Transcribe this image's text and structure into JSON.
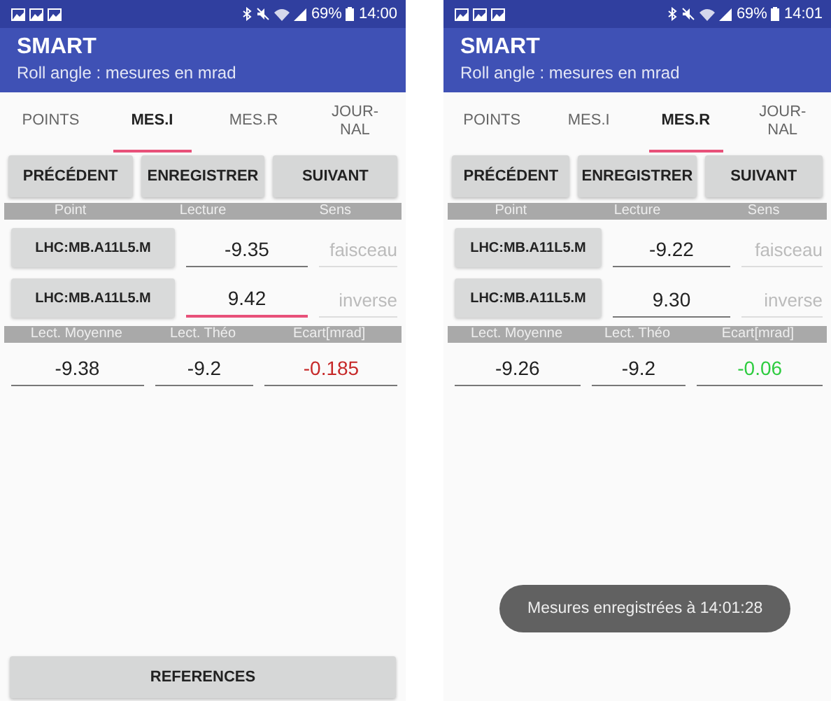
{
  "screens": [
    {
      "status_bar": {
        "battery": "69%",
        "time": "14:00"
      },
      "app_bar": {
        "title": "SMART",
        "subtitle": "Roll angle : mesures en mrad"
      },
      "tabs": [
        {
          "label": "POINTS",
          "selected": false
        },
        {
          "label": "MES.I",
          "selected": true
        },
        {
          "label": "MES.R",
          "selected": false
        },
        {
          "label": "JOUR-\nNAL",
          "selected": false
        }
      ],
      "buttons": [
        "PRÉCÉDENT",
        "ENREGISTRER",
        "SUIVANT"
      ],
      "columns": [
        "Point",
        "Lecture",
        "Sens"
      ],
      "rows": [
        {
          "point": "LHC:MB.A11L5.M",
          "reading": "-9.35",
          "focused": false,
          "sens": "faisceau"
        },
        {
          "point": "LHC:MB.A11L5.M",
          "reading": "9.42",
          "focused": true,
          "sens": "inverse"
        }
      ],
      "summary_columns": [
        "Lect. Moyenne",
        "Lect. Théo",
        "Ecart[mrad]"
      ],
      "summary": {
        "mean": "-9.38",
        "theo": "-9.2",
        "ecart": "-0.185",
        "color": "#c62828"
      },
      "bottom_button": "REFERENCES"
    },
    {
      "status_bar": {
        "battery": "69%",
        "time": "14:01"
      },
      "app_bar": {
        "title": "SMART",
        "subtitle": "Roll angle : mesures en mrad"
      },
      "tabs": [
        {
          "label": "POINTS",
          "selected": false
        },
        {
          "label": "MES.I",
          "selected": false
        },
        {
          "label": "MES.R",
          "selected": true
        },
        {
          "label": "JOUR-\nNAL",
          "selected": false
        }
      ],
      "buttons": [
        "PRÉCÉDENT",
        "ENREGISTRER",
        "SUIVANT"
      ],
      "columns": [
        "Point",
        "Lecture",
        "Sens"
      ],
      "rows": [
        {
          "point": "LHC:MB.A11L5.M",
          "reading": "-9.22",
          "focused": false,
          "sens": "faisceau"
        },
        {
          "point": "LHC:MB.A11L5.M",
          "reading": "9.30",
          "focused": false,
          "sens": "inverse"
        }
      ],
      "summary_columns": [
        "Lect. Moyenne",
        "Lect. Théo",
        "Ecart[mrad]"
      ],
      "summary": {
        "mean": "-9.26",
        "theo": "-9.2",
        "ecart": "-0.06",
        "color": "#2ecc40"
      },
      "toast": "Mesures enregistrées à 14:01:28"
    }
  ]
}
